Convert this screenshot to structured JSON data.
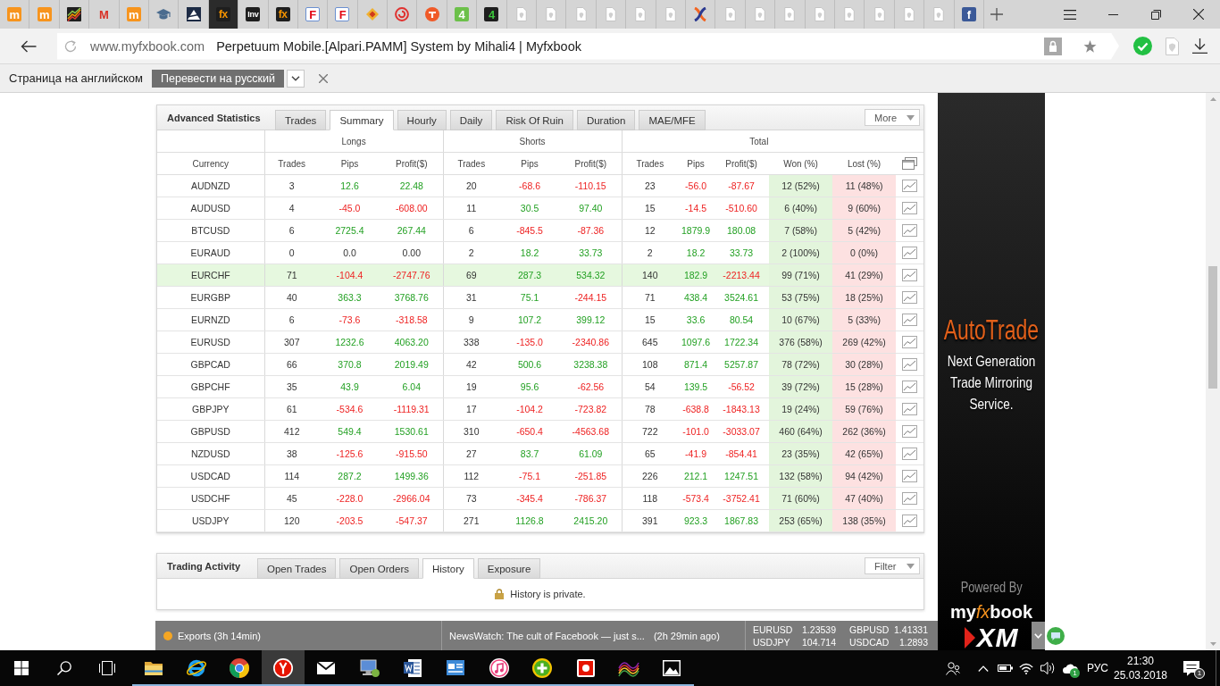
{
  "browser": {
    "tabs": [
      {
        "kind": "orangetile",
        "glyph": "m",
        "selected": false
      },
      {
        "kind": "orangetile",
        "glyph": "m",
        "selected": false
      },
      {
        "kind": "chart",
        "selected": false
      },
      {
        "kind": "redletter",
        "glyph": "M",
        "selected": false
      },
      {
        "kind": "orangetile",
        "glyph": "m",
        "selected": false
      },
      {
        "kind": "cap",
        "selected": false
      },
      {
        "kind": "peak",
        "selected": false
      },
      {
        "kind": "amberdark",
        "glyph": "fx",
        "selected": true
      },
      {
        "kind": "whitedark",
        "glyph": "Inv",
        "selected": false
      },
      {
        "kind": "amberdark",
        "glyph": "fx",
        "selected": false
      },
      {
        "kind": "redframed",
        "glyph": "F",
        "selected": false
      },
      {
        "kind": "redframed",
        "glyph": "F",
        "selected": false
      },
      {
        "kind": "diamond",
        "selected": false
      },
      {
        "kind": "spiral",
        "selected": false
      },
      {
        "kind": "disc",
        "selected": false
      },
      {
        "kind": "greentile",
        "glyph": "4",
        "selected": false
      },
      {
        "kind": "greendark",
        "glyph": "4",
        "selected": false
      },
      {
        "kind": "page",
        "selected": false
      },
      {
        "kind": "page",
        "selected": false
      },
      {
        "kind": "page",
        "selected": false
      },
      {
        "kind": "page",
        "selected": false
      },
      {
        "kind": "page",
        "selected": false
      },
      {
        "kind": "page",
        "selected": false
      },
      {
        "kind": "swirl",
        "selected": false
      },
      {
        "kind": "page",
        "selected": false
      },
      {
        "kind": "page",
        "selected": false
      },
      {
        "kind": "page",
        "selected": false
      },
      {
        "kind": "page",
        "selected": false
      },
      {
        "kind": "page",
        "selected": false
      },
      {
        "kind": "page",
        "selected": false
      },
      {
        "kind": "page",
        "selected": false
      },
      {
        "kind": "page",
        "selected": false
      },
      {
        "kind": "bluetile",
        "glyph": "f",
        "selected": false
      }
    ],
    "address": {
      "domain": "www.myfxbook.com",
      "title": "Perpetuum Mobile.[Alpari.PAMM] System by Mihali4 | Myfxbook"
    }
  },
  "translate_bar": {
    "message": "Страница на английском",
    "button": "Перевести на русский"
  },
  "advanced_statistics": {
    "title": "Advanced Statistics",
    "tabs": [
      {
        "label": "Trades",
        "selected": false
      },
      {
        "label": "Summary",
        "selected": true
      },
      {
        "label": "Hourly",
        "selected": false
      },
      {
        "label": "Daily",
        "selected": false
      },
      {
        "label": "Risk Of Ruin",
        "selected": false
      },
      {
        "label": "Duration",
        "selected": false
      },
      {
        "label": "MAE/MFE",
        "selected": false
      }
    ],
    "menu": "More",
    "table": {
      "groups": [
        "Longs",
        "Shorts",
        "Total"
      ],
      "columns": [
        "Currency",
        "Trades",
        "Pips",
        "Profit($)",
        "Trades",
        "Pips",
        "Profit($)",
        "Trades",
        "Pips",
        "Profit($)",
        "Won (%)",
        "Lost (%)"
      ],
      "rows": [
        {
          "currency": "AUDNZD",
          "selected": false,
          "longs": {
            "trades": "3",
            "pips": {
              "text": "12.6",
              "gain": true,
              "loss": false
            },
            "profit": {
              "text": "22.48",
              "gain": true,
              "loss": false
            }
          },
          "shorts": {
            "trades": "20",
            "pips": {
              "text": "-68.6",
              "gain": false,
              "loss": true
            },
            "profit": {
              "text": "-110.15",
              "gain": false,
              "loss": true
            }
          },
          "total": {
            "trades": "23",
            "pips": {
              "text": "-56.0",
              "gain": false,
              "loss": true
            },
            "profit": {
              "text": "-87.67",
              "gain": false,
              "loss": true
            }
          },
          "won": "12 (52%)",
          "lost": "11 (48%)"
        },
        {
          "currency": "AUDUSD",
          "selected": false,
          "longs": {
            "trades": "4",
            "pips": {
              "text": "-45.0",
              "gain": false,
              "loss": true
            },
            "profit": {
              "text": "-608.00",
              "gain": false,
              "loss": true
            }
          },
          "shorts": {
            "trades": "11",
            "pips": {
              "text": "30.5",
              "gain": true,
              "loss": false
            },
            "profit": {
              "text": "97.40",
              "gain": true,
              "loss": false
            }
          },
          "total": {
            "trades": "15",
            "pips": {
              "text": "-14.5",
              "gain": false,
              "loss": true
            },
            "profit": {
              "text": "-510.60",
              "gain": false,
              "loss": true
            }
          },
          "won": "6 (40%)",
          "lost": "9 (60%)"
        },
        {
          "currency": "BTCUSD",
          "selected": false,
          "longs": {
            "trades": "6",
            "pips": {
              "text": "2725.4",
              "gain": true,
              "loss": false
            },
            "profit": {
              "text": "267.44",
              "gain": true,
              "loss": false
            }
          },
          "shorts": {
            "trades": "6",
            "pips": {
              "text": "-845.5",
              "gain": false,
              "loss": true
            },
            "profit": {
              "text": "-87.36",
              "gain": false,
              "loss": true
            }
          },
          "total": {
            "trades": "12",
            "pips": {
              "text": "1879.9",
              "gain": true,
              "loss": false
            },
            "profit": {
              "text": "180.08",
              "gain": true,
              "loss": false
            }
          },
          "won": "7 (58%)",
          "lost": "5 (42%)"
        },
        {
          "currency": "EURAUD",
          "selected": false,
          "longs": {
            "trades": "0",
            "pips": {
              "text": "0.0",
              "gain": false,
              "loss": false
            },
            "profit": {
              "text": "0.00",
              "gain": false,
              "loss": false
            }
          },
          "shorts": {
            "trades": "2",
            "pips": {
              "text": "18.2",
              "gain": true,
              "loss": false
            },
            "profit": {
              "text": "33.73",
              "gain": true,
              "loss": false
            }
          },
          "total": {
            "trades": "2",
            "pips": {
              "text": "18.2",
              "gain": true,
              "loss": false
            },
            "profit": {
              "text": "33.73",
              "gain": true,
              "loss": false
            }
          },
          "won": "2 (100%)",
          "lost": "0 (0%)"
        },
        {
          "currency": "EURCHF",
          "selected": true,
          "longs": {
            "trades": "71",
            "pips": {
              "text": "-104.4",
              "gain": false,
              "loss": true
            },
            "profit": {
              "text": "-2747.76",
              "gain": false,
              "loss": true
            }
          },
          "shorts": {
            "trades": "69",
            "pips": {
              "text": "287.3",
              "gain": true,
              "loss": false
            },
            "profit": {
              "text": "534.32",
              "gain": true,
              "loss": false
            }
          },
          "total": {
            "trades": "140",
            "pips": {
              "text": "182.9",
              "gain": true,
              "loss": false
            },
            "profit": {
              "text": "-2213.44",
              "gain": false,
              "loss": true
            }
          },
          "won": "99 (71%)",
          "lost": "41 (29%)"
        },
        {
          "currency": "EURGBP",
          "selected": false,
          "longs": {
            "trades": "40",
            "pips": {
              "text": "363.3",
              "gain": true,
              "loss": false
            },
            "profit": {
              "text": "3768.76",
              "gain": true,
              "loss": false
            }
          },
          "shorts": {
            "trades": "31",
            "pips": {
              "text": "75.1",
              "gain": true,
              "loss": false
            },
            "profit": {
              "text": "-244.15",
              "gain": false,
              "loss": true
            }
          },
          "total": {
            "trades": "71",
            "pips": {
              "text": "438.4",
              "gain": true,
              "loss": false
            },
            "profit": {
              "text": "3524.61",
              "gain": true,
              "loss": false
            }
          },
          "won": "53 (75%)",
          "lost": "18 (25%)"
        },
        {
          "currency": "EURNZD",
          "selected": false,
          "longs": {
            "trades": "6",
            "pips": {
              "text": "-73.6",
              "gain": false,
              "loss": true
            },
            "profit": {
              "text": "-318.58",
              "gain": false,
              "loss": true
            }
          },
          "shorts": {
            "trades": "9",
            "pips": {
              "text": "107.2",
              "gain": true,
              "loss": false
            },
            "profit": {
              "text": "399.12",
              "gain": true,
              "loss": false
            }
          },
          "total": {
            "trades": "15",
            "pips": {
              "text": "33.6",
              "gain": true,
              "loss": false
            },
            "profit": {
              "text": "80.54",
              "gain": true,
              "loss": false
            }
          },
          "won": "10 (67%)",
          "lost": "5 (33%)"
        },
        {
          "currency": "EURUSD",
          "selected": false,
          "longs": {
            "trades": "307",
            "pips": {
              "text": "1232.6",
              "gain": true,
              "loss": false
            },
            "profit": {
              "text": "4063.20",
              "gain": true,
              "loss": false
            }
          },
          "shorts": {
            "trades": "338",
            "pips": {
              "text": "-135.0",
              "gain": false,
              "loss": true
            },
            "profit": {
              "text": "-2340.86",
              "gain": false,
              "loss": true
            }
          },
          "total": {
            "trades": "645",
            "pips": {
              "text": "1097.6",
              "gain": true,
              "loss": false
            },
            "profit": {
              "text": "1722.34",
              "gain": true,
              "loss": false
            }
          },
          "won": "376 (58%)",
          "lost": "269 (42%)"
        },
        {
          "currency": "GBPCAD",
          "selected": false,
          "longs": {
            "trades": "66",
            "pips": {
              "text": "370.8",
              "gain": true,
              "loss": false
            },
            "profit": {
              "text": "2019.49",
              "gain": true,
              "loss": false
            }
          },
          "shorts": {
            "trades": "42",
            "pips": {
              "text": "500.6",
              "gain": true,
              "loss": false
            },
            "profit": {
              "text": "3238.38",
              "gain": true,
              "loss": false
            }
          },
          "total": {
            "trades": "108",
            "pips": {
              "text": "871.4",
              "gain": true,
              "loss": false
            },
            "profit": {
              "text": "5257.87",
              "gain": true,
              "loss": false
            }
          },
          "won": "78 (72%)",
          "lost": "30 (28%)"
        },
        {
          "currency": "GBPCHF",
          "selected": false,
          "longs": {
            "trades": "35",
            "pips": {
              "text": "43.9",
              "gain": true,
              "loss": false
            },
            "profit": {
              "text": "6.04",
              "gain": true,
              "loss": false
            }
          },
          "shorts": {
            "trades": "19",
            "pips": {
              "text": "95.6",
              "gain": true,
              "loss": false
            },
            "profit": {
              "text": "-62.56",
              "gain": false,
              "loss": true
            }
          },
          "total": {
            "trades": "54",
            "pips": {
              "text": "139.5",
              "gain": true,
              "loss": false
            },
            "profit": {
              "text": "-56.52",
              "gain": false,
              "loss": true
            }
          },
          "won": "39 (72%)",
          "lost": "15 (28%)"
        },
        {
          "currency": "GBPJPY",
          "selected": false,
          "longs": {
            "trades": "61",
            "pips": {
              "text": "-534.6",
              "gain": false,
              "loss": true
            },
            "profit": {
              "text": "-1119.31",
              "gain": false,
              "loss": true
            }
          },
          "shorts": {
            "trades": "17",
            "pips": {
              "text": "-104.2",
              "gain": false,
              "loss": true
            },
            "profit": {
              "text": "-723.82",
              "gain": false,
              "loss": true
            }
          },
          "total": {
            "trades": "78",
            "pips": {
              "text": "-638.8",
              "gain": false,
              "loss": true
            },
            "profit": {
              "text": "-1843.13",
              "gain": false,
              "loss": true
            }
          },
          "won": "19 (24%)",
          "lost": "59 (76%)"
        },
        {
          "currency": "GBPUSD",
          "selected": false,
          "longs": {
            "trades": "412",
            "pips": {
              "text": "549.4",
              "gain": true,
              "loss": false
            },
            "profit": {
              "text": "1530.61",
              "gain": true,
              "loss": false
            }
          },
          "shorts": {
            "trades": "310",
            "pips": {
              "text": "-650.4",
              "gain": false,
              "loss": true
            },
            "profit": {
              "text": "-4563.68",
              "gain": false,
              "loss": true
            }
          },
          "total": {
            "trades": "722",
            "pips": {
              "text": "-101.0",
              "gain": false,
              "loss": true
            },
            "profit": {
              "text": "-3033.07",
              "gain": false,
              "loss": true
            }
          },
          "won": "460 (64%)",
          "lost": "262 (36%)"
        },
        {
          "currency": "NZDUSD",
          "selected": false,
          "longs": {
            "trades": "38",
            "pips": {
              "text": "-125.6",
              "gain": false,
              "loss": true
            },
            "profit": {
              "text": "-915.50",
              "gain": false,
              "loss": true
            }
          },
          "shorts": {
            "trades": "27",
            "pips": {
              "text": "83.7",
              "gain": true,
              "loss": false
            },
            "profit": {
              "text": "61.09",
              "gain": true,
              "loss": false
            }
          },
          "total": {
            "trades": "65",
            "pips": {
              "text": "-41.9",
              "gain": false,
              "loss": true
            },
            "profit": {
              "text": "-854.41",
              "gain": false,
              "loss": true
            }
          },
          "won": "23 (35%)",
          "lost": "42 (65%)"
        },
        {
          "currency": "USDCAD",
          "selected": false,
          "longs": {
            "trades": "114",
            "pips": {
              "text": "287.2",
              "gain": true,
              "loss": false
            },
            "profit": {
              "text": "1499.36",
              "gain": true,
              "loss": false
            }
          },
          "shorts": {
            "trades": "112",
            "pips": {
              "text": "-75.1",
              "gain": false,
              "loss": true
            },
            "profit": {
              "text": "-251.85",
              "gain": false,
              "loss": true
            }
          },
          "total": {
            "trades": "226",
            "pips": {
              "text": "212.1",
              "gain": true,
              "loss": false
            },
            "profit": {
              "text": "1247.51",
              "gain": true,
              "loss": false
            }
          },
          "won": "132 (58%)",
          "lost": "94 (42%)"
        },
        {
          "currency": "USDCHF",
          "selected": false,
          "longs": {
            "trades": "45",
            "pips": {
              "text": "-228.0",
              "gain": false,
              "loss": true
            },
            "profit": {
              "text": "-2966.04",
              "gain": false,
              "loss": true
            }
          },
          "shorts": {
            "trades": "73",
            "pips": {
              "text": "-345.4",
              "gain": false,
              "loss": true
            },
            "profit": {
              "text": "-786.37",
              "gain": false,
              "loss": true
            }
          },
          "total": {
            "trades": "118",
            "pips": {
              "text": "-573.4",
              "gain": false,
              "loss": true
            },
            "profit": {
              "text": "-3752.41",
              "gain": false,
              "loss": true
            }
          },
          "won": "71 (60%)",
          "lost": "47 (40%)"
        },
        {
          "currency": "USDJPY",
          "selected": false,
          "longs": {
            "trades": "120",
            "pips": {
              "text": "-203.5",
              "gain": false,
              "loss": true
            },
            "profit": {
              "text": "-547.37",
              "gain": false,
              "loss": true
            }
          },
          "shorts": {
            "trades": "271",
            "pips": {
              "text": "1126.8",
              "gain": true,
              "loss": false
            },
            "profit": {
              "text": "2415.20",
              "gain": true,
              "loss": false
            }
          },
          "total": {
            "trades": "391",
            "pips": {
              "text": "923.3",
              "gain": true,
              "loss": false
            },
            "profit": {
              "text": "1867.83",
              "gain": true,
              "loss": false
            }
          },
          "won": "253 (65%)",
          "lost": "138 (35%)"
        }
      ]
    }
  },
  "trading_activity": {
    "title": "Trading Activity",
    "tabs": [
      {
        "label": "Open Trades",
        "selected": false
      },
      {
        "label": "Open Orders",
        "selected": false
      },
      {
        "label": "History",
        "selected": true
      },
      {
        "label": "Exposure",
        "selected": false
      }
    ],
    "menu": "Filter",
    "message": "History is private."
  },
  "ticker": {
    "exports": "Exports (3h 14min)",
    "news": "NewsWatch: The cult of Facebook — just s...",
    "news_age": "(2h 29min ago)",
    "rates": [
      {
        "pair": "EURUSD",
        "price": "1.23539"
      },
      {
        "pair": "GBPUSD",
        "price": "1.41331"
      },
      {
        "pair": "USDJPY",
        "price": "104.714"
      },
      {
        "pair": "USDCAD",
        "price": "1.2893"
      }
    ]
  },
  "ad": {
    "headline": "AutoTrade",
    "tagline": "Next Generation Trade Mirroring Service.",
    "powered_by": "Powered By",
    "logo": [
      "my",
      "fx",
      "book"
    ],
    "partner": "XM"
  },
  "taskbar": {
    "apps": [
      {
        "kind": "folder",
        "selected": false,
        "running": true
      },
      {
        "kind": "ie",
        "selected": false,
        "running": true
      },
      {
        "kind": "chrome",
        "selected": false,
        "running": true
      },
      {
        "kind": "yandex",
        "selected": true,
        "running": true
      },
      {
        "kind": "mail",
        "selected": false,
        "running": true
      },
      {
        "kind": "monitor",
        "selected": false,
        "running": true
      },
      {
        "kind": "word",
        "selected": false,
        "running": true
      },
      {
        "kind": "window",
        "selected": false,
        "running": true
      },
      {
        "kind": "music",
        "selected": false,
        "running": true
      },
      {
        "kind": "plus",
        "selected": false,
        "running": true
      },
      {
        "kind": "square",
        "selected": false,
        "running": true
      },
      {
        "kind": "wave",
        "selected": false,
        "running": true
      },
      {
        "kind": "photo",
        "selected": false,
        "running": true
      }
    ],
    "sync_count": "1",
    "language": "РУС",
    "time": "21:30",
    "date": "25.03.2018",
    "notifications": "1"
  }
}
